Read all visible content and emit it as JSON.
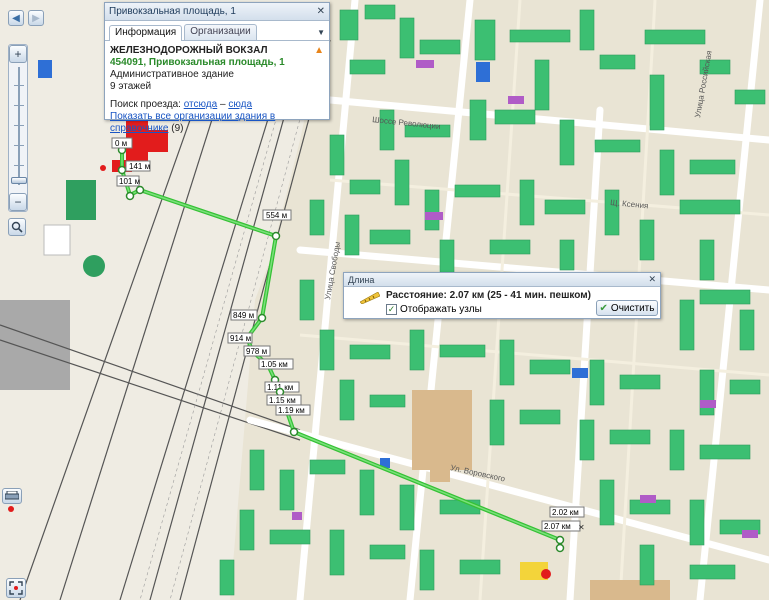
{
  "popup": {
    "title": "Привокзальная площадь, 1",
    "tabs": [
      {
        "label": "Информация",
        "active": true
      },
      {
        "label": "Организации",
        "active": false
      }
    ],
    "name": "ЖЕЛЕЗНОДОРОЖНЫЙ ВОКЗАЛ",
    "address": "454091, Привокзальная площадь, 1",
    "type": "Административное здание",
    "floors": "9 этажей",
    "route_label": "Поиск проезда:",
    "route_from": "отсюда",
    "route_dash": "–",
    "route_to": "сюда",
    "show_all": "Показать все организации здания в справочнике",
    "count": "(9)"
  },
  "distance": {
    "header": "Длина",
    "text": "Расстояние: 2.07 км (25 - 41 мин. пешком)",
    "show_nodes_label": "Отображать узлы",
    "show_nodes_checked": true,
    "clear_label": "Очистить"
  },
  "route": {
    "color": "#35c135",
    "labels": [
      "0 м",
      "141 м",
      "101 м",
      "554 м",
      "849 м",
      "914 м",
      "978 м",
      "1.05 км",
      "1.11 км",
      "1.15 км",
      "1.19 км",
      "2.02 км",
      "2.07 км"
    ]
  },
  "streets": {
    "n1": "Шоссе Революции",
    "n2": "Щ. Ксения",
    "n3": "Улица Российская",
    "n4": "Улица Свободы",
    "n5": "Ул. Воровского"
  },
  "colors": {
    "map_bg": "#e9e4d4",
    "building": "#3cbf72",
    "building_dark": "#2d9a5c",
    "accent_purple": "#b05cc7",
    "accent_blue": "#2e6fd6",
    "station_red": "#e21c1c"
  }
}
